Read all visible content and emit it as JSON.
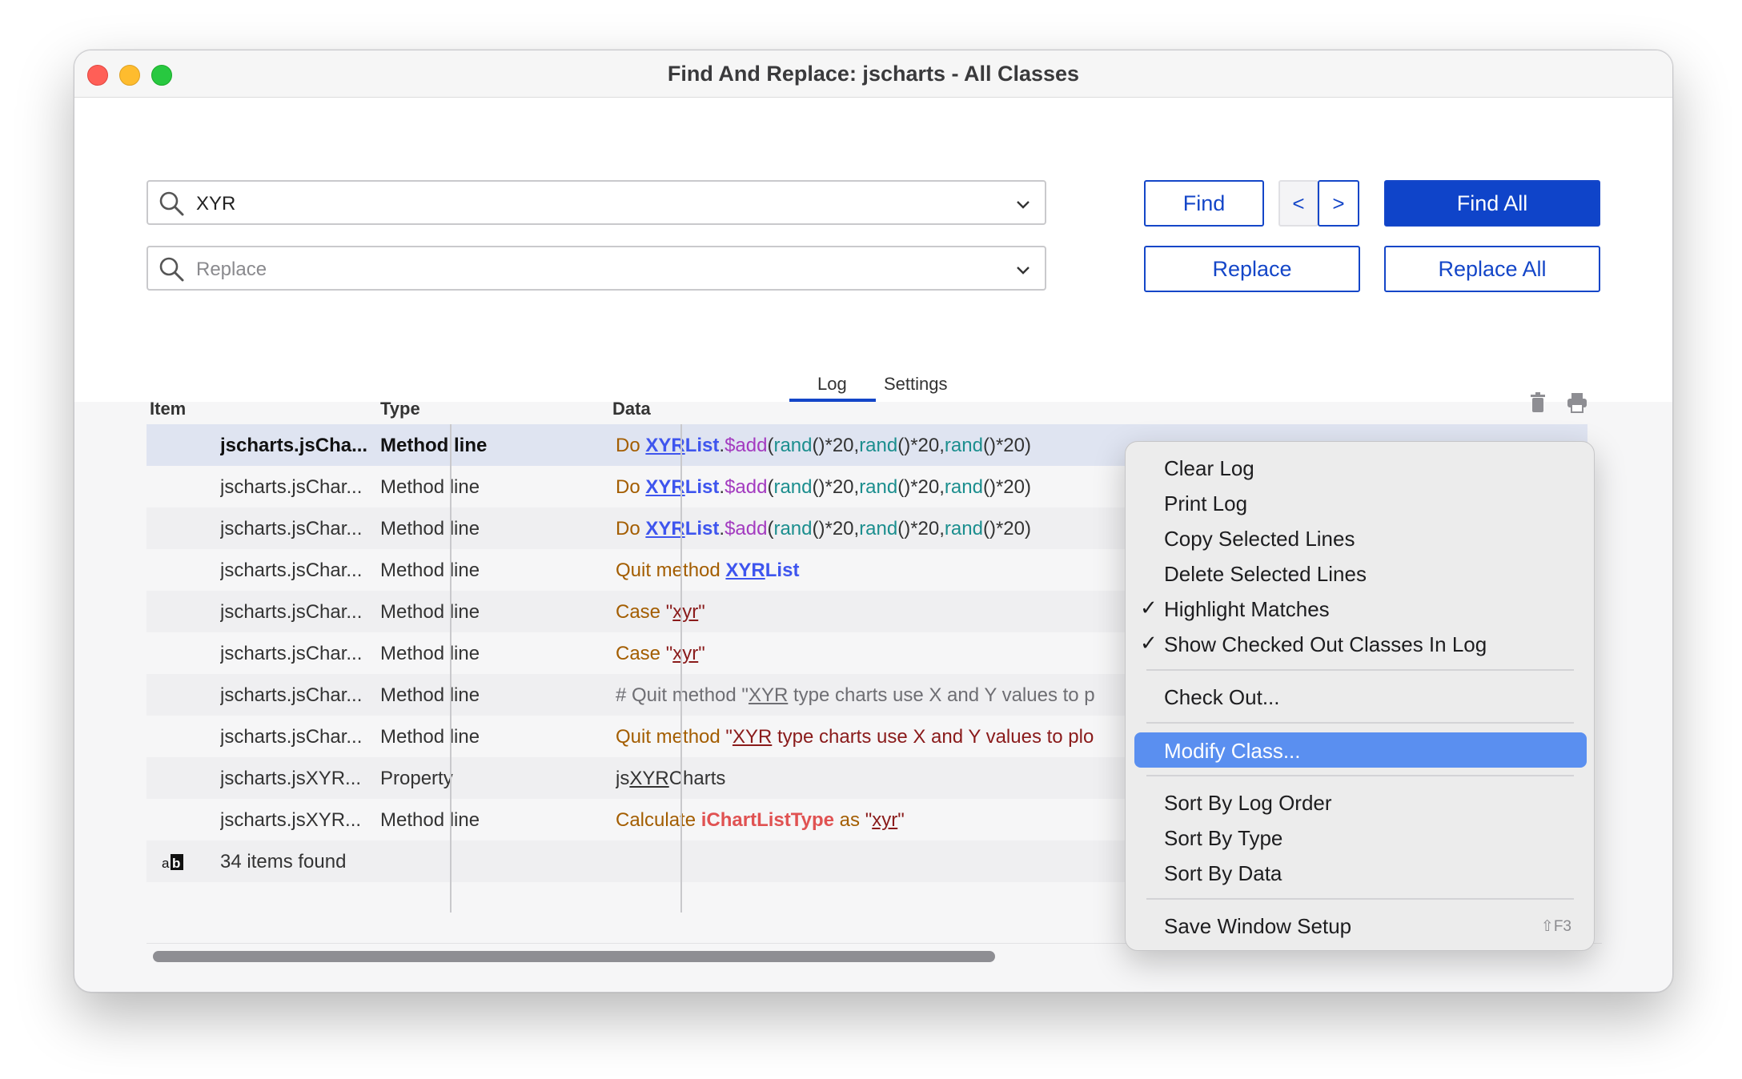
{
  "window": {
    "title": "Find And Replace: jscharts - All Classes"
  },
  "search": {
    "find_value": "XYR",
    "replace_placeholder": "Replace"
  },
  "buttons": {
    "find": "Find",
    "prev": "<",
    "next": ">",
    "find_all": "Find All",
    "replace": "Replace",
    "replace_all": "Replace All"
  },
  "tabs": {
    "log": "Log",
    "settings": "Settings"
  },
  "table": {
    "headers": {
      "item": "Item",
      "type": "Type",
      "data": "Data"
    },
    "rows": [
      {
        "item": "jscharts.jsCha...",
        "type": "Method line"
      },
      {
        "item": "jscharts.jsChar...",
        "type": "Method line"
      },
      {
        "item": "jscharts.jsChar...",
        "type": "Method line"
      },
      {
        "item": "jscharts.jsChar...",
        "type": "Method line"
      },
      {
        "item": "jscharts.jsChar...",
        "type": "Method line"
      },
      {
        "item": "jscharts.jsChar...",
        "type": "Method line"
      },
      {
        "item": "jscharts.jsChar...",
        "type": "Method line"
      },
      {
        "item": "jscharts.jsChar...",
        "type": "Method line"
      },
      {
        "item": "jscharts.jsXYR...",
        "type": "Property"
      },
      {
        "item": "jscharts.jsXYR...",
        "type": "Method line"
      }
    ],
    "data_tokens": {
      "do": "Do",
      "xyr": "XYR",
      "list": "List",
      "dot": ".",
      "add": "$add",
      "open": "(",
      "rand": "rand",
      "times20c": "()*20,",
      "times20e": "()*20)",
      "quit_method": "Quit method",
      "case": "Case",
      "quote": "\"",
      "xyr_lower": "xyr",
      "comment_prefix": "# Quit method \"",
      "comment_rest": " type charts use X and Y values to p",
      "str_rest": " type charts use X and Y values to plo",
      "js": "js",
      "charts": "Charts",
      "calculate": "Calculate",
      "ichart": "iChartListType",
      "as": "as"
    },
    "footer": {
      "count": "34 items found",
      "icon": "ab-icon"
    }
  },
  "context_menu": {
    "items": [
      {
        "label": "Clear Log"
      },
      {
        "label": "Print Log"
      },
      {
        "label": "Copy Selected Lines"
      },
      {
        "label": "Delete Selected Lines"
      },
      {
        "label": "Highlight Matches",
        "checked": true
      },
      {
        "label": "Show Checked Out Classes In Log",
        "checked": true
      },
      {
        "label": "Check Out..."
      },
      {
        "label": "Modify Class...",
        "highlighted": true
      },
      {
        "label": "Sort By Log Order"
      },
      {
        "label": "Sort By Type"
      },
      {
        "label": "Sort By Data"
      },
      {
        "label": "Save Window Setup",
        "shortcut": "⇧F3"
      }
    ],
    "checkmark": "✓"
  },
  "colors": {
    "accent": "#0f44c9",
    "menu_highlight": "#5a8ff0"
  }
}
